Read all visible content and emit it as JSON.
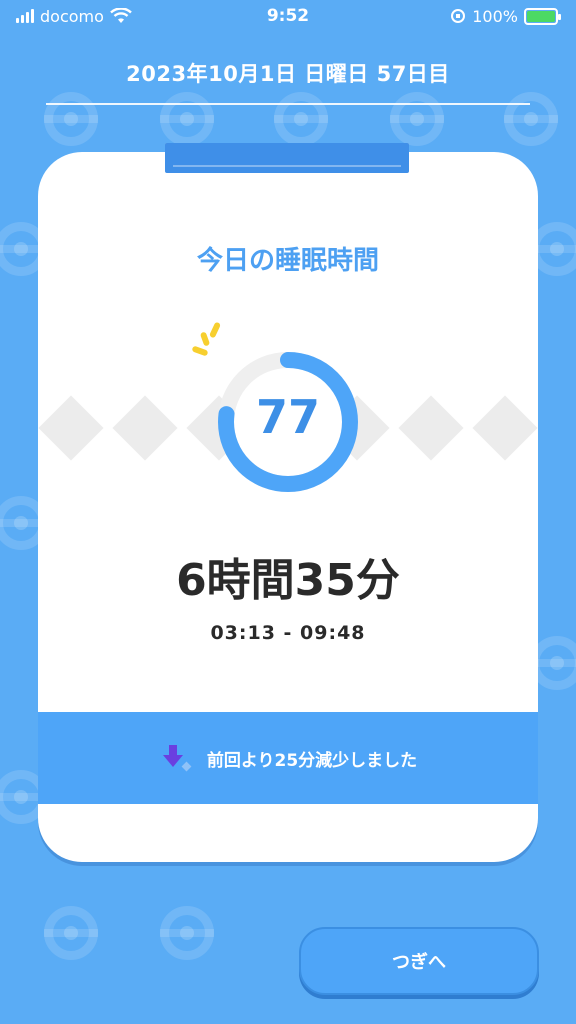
{
  "status_bar": {
    "carrier": "docomo",
    "time": "9:52",
    "battery": "100%"
  },
  "header": {
    "date_text": "2023年10月1日 日曜日 57日目"
  },
  "card": {
    "title": "今日の睡眠時間",
    "score": "77",
    "score_fraction": 0.77,
    "duration": "6時間35分",
    "time_range": "03:13 - 09:48",
    "comparison_text": "前回より25分減少しました"
  },
  "buttons": {
    "next_label": "つぎへ"
  },
  "colors": {
    "background": "#5aacf5",
    "accent": "#4da0f2",
    "ring": "#4ea5f8",
    "ring_track": "#efefef",
    "arrow": "#6a3fe0",
    "spark": "#f7cf2f"
  },
  "icons": {
    "decrease": "down-arrow-icon",
    "sparkle": "sparkle-icon"
  }
}
